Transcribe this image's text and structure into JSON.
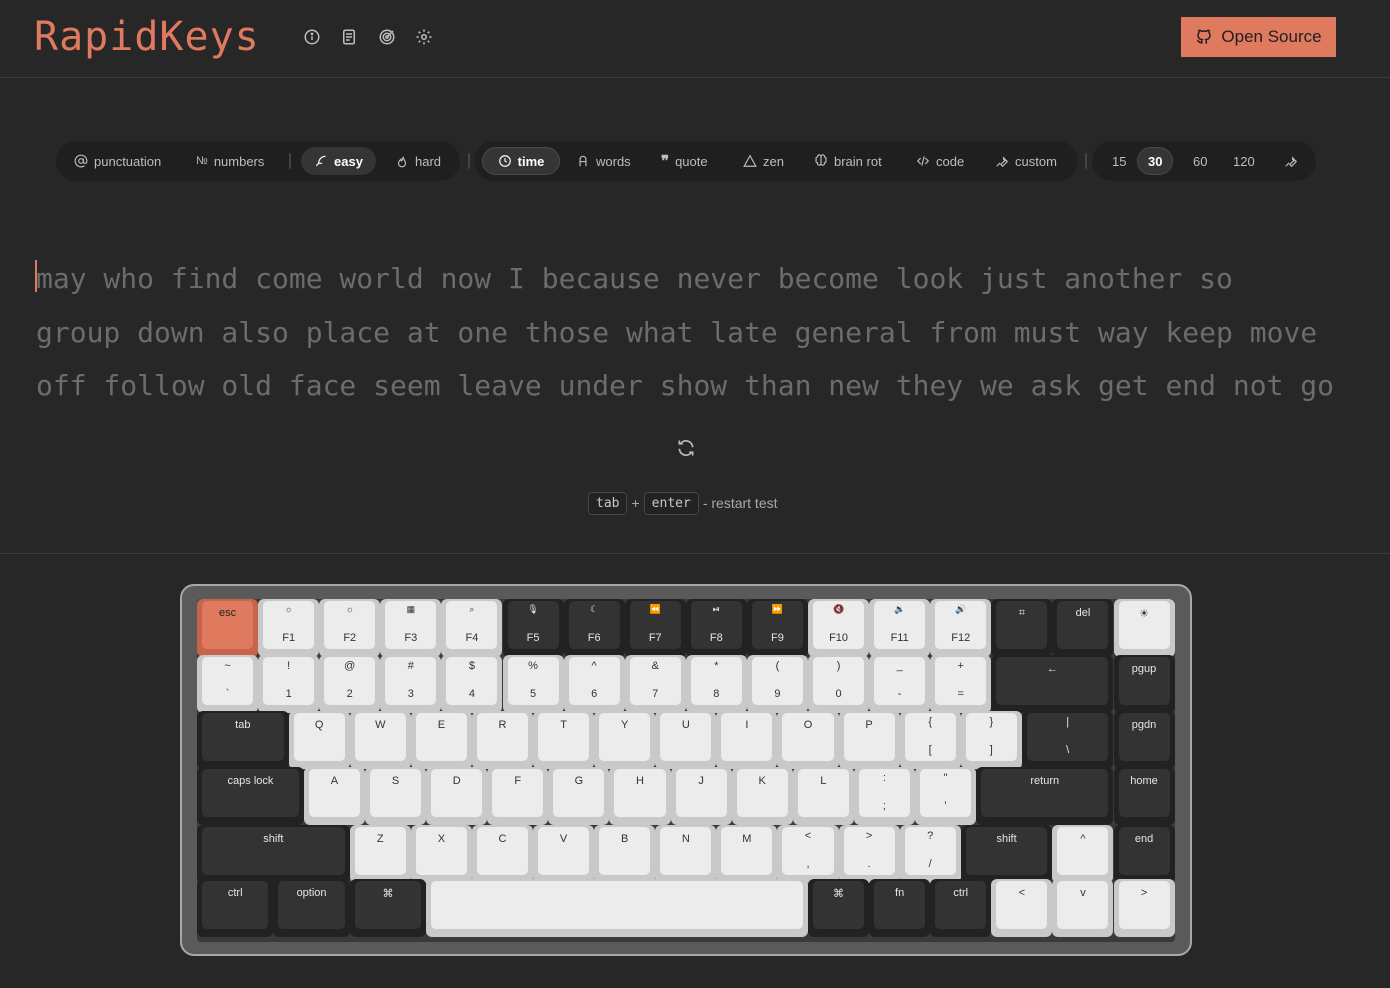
{
  "header": {
    "logo": "RapidKeys",
    "icons": [
      "info-icon",
      "document-icon",
      "target-icon",
      "settings-icon"
    ],
    "open_source_label": "Open Source"
  },
  "toolbar": {
    "punctuation": "punctuation",
    "numbers": "numbers",
    "easy": "easy",
    "hard": "hard",
    "time": "time",
    "words": "words",
    "quote": "quote",
    "zen": "zen",
    "brain_rot": "brain rot",
    "code": "code",
    "custom": "custom",
    "durations": [
      "15",
      "30",
      "60",
      "120"
    ],
    "selected_duration": "30"
  },
  "test": {
    "line1": "may who find come world now I because never become look just another so",
    "line2": "group down also place at one those what late general from must way keep move",
    "line3": "off follow old face seem leave under show than new they we ask get end not go"
  },
  "hint": {
    "key1": "tab",
    "plus": "+",
    "key2": "enter",
    "text": "- restart test"
  },
  "keyboard": {
    "row1": [
      {
        "top": "esc",
        "bottom": ""
      },
      {
        "icon": "☼",
        "bottom": "F1"
      },
      {
        "icon": "☼",
        "bottom": "F2"
      },
      {
        "icon": "▦",
        "bottom": "F3"
      },
      {
        "icon": "⌕",
        "bottom": "F4"
      },
      {
        "icon": "🎙",
        "bottom": "F5"
      },
      {
        "icon": "☾",
        "bottom": "F6"
      },
      {
        "icon": "⏪",
        "bottom": "F7"
      },
      {
        "icon": "⏯",
        "bottom": "F8"
      },
      {
        "icon": "⏩",
        "bottom": "F9"
      },
      {
        "icon": "🔇",
        "bottom": "F10"
      },
      {
        "icon": "🔉",
        "bottom": "F11"
      },
      {
        "icon": "🔊",
        "bottom": "F12"
      },
      {
        "top": "⌗",
        "bottom": ""
      },
      {
        "top": "del",
        "bottom": ""
      },
      {
        "top": "☀",
        "bottom": ""
      }
    ],
    "row2": [
      {
        "top": "~",
        "bottom": "`"
      },
      {
        "top": "!",
        "bottom": "1"
      },
      {
        "top": "@",
        "bottom": "2"
      },
      {
        "top": "#",
        "bottom": "3"
      },
      {
        "top": "$",
        "bottom": "4"
      },
      {
        "top": "%",
        "bottom": "5"
      },
      {
        "top": "^",
        "bottom": "6"
      },
      {
        "top": "&",
        "bottom": "7"
      },
      {
        "top": "*",
        "bottom": "8"
      },
      {
        "top": "(",
        "bottom": "9"
      },
      {
        "top": ")",
        "bottom": "0"
      },
      {
        "top": "_",
        "bottom": "-"
      },
      {
        "top": "+",
        "bottom": "="
      },
      {
        "top": "←",
        "bottom": ""
      },
      {
        "top": "pgup",
        "bottom": ""
      }
    ],
    "row3": [
      {
        "top": "tab",
        "bottom": ""
      },
      {
        "top": "Q",
        "bottom": ""
      },
      {
        "top": "W",
        "bottom": ""
      },
      {
        "top": "E",
        "bottom": ""
      },
      {
        "top": "R",
        "bottom": ""
      },
      {
        "top": "T",
        "bottom": ""
      },
      {
        "top": "Y",
        "bottom": ""
      },
      {
        "top": "U",
        "bottom": ""
      },
      {
        "top": "I",
        "bottom": ""
      },
      {
        "top": "O",
        "bottom": ""
      },
      {
        "top": "P",
        "bottom": ""
      },
      {
        "top": "{",
        "bottom": "["
      },
      {
        "top": "}",
        "bottom": "]"
      },
      {
        "top": "|",
        "bottom": "\\"
      },
      {
        "top": "pgdn",
        "bottom": ""
      }
    ],
    "row4": [
      {
        "top": "caps lock",
        "bottom": ""
      },
      {
        "top": "A",
        "bottom": ""
      },
      {
        "top": "S",
        "bottom": ""
      },
      {
        "top": "D",
        "bottom": ""
      },
      {
        "top": "F",
        "bottom": ""
      },
      {
        "top": "G",
        "bottom": ""
      },
      {
        "top": "H",
        "bottom": ""
      },
      {
        "top": "J",
        "bottom": ""
      },
      {
        "top": "K",
        "bottom": ""
      },
      {
        "top": "L",
        "bottom": ""
      },
      {
        "top": ":",
        "bottom": ";"
      },
      {
        "top": "\"",
        "bottom": "'"
      },
      {
        "top": "return",
        "bottom": ""
      },
      {
        "top": "home",
        "bottom": ""
      }
    ],
    "row5": [
      {
        "top": "shift",
        "bottom": ""
      },
      {
        "top": "Z",
        "bottom": ""
      },
      {
        "top": "X",
        "bottom": ""
      },
      {
        "top": "C",
        "bottom": ""
      },
      {
        "top": "V",
        "bottom": ""
      },
      {
        "top": "B",
        "bottom": ""
      },
      {
        "top": "N",
        "bottom": ""
      },
      {
        "top": "M",
        "bottom": ""
      },
      {
        "top": "<",
        "bottom": ","
      },
      {
        "top": ">",
        "bottom": "."
      },
      {
        "top": "?",
        "bottom": "/"
      },
      {
        "top": "shift",
        "bottom": ""
      },
      {
        "top": "^",
        "bottom": ""
      },
      {
        "top": "end",
        "bottom": ""
      }
    ],
    "row6": [
      {
        "top": "ctrl",
        "bottom": ""
      },
      {
        "top": "option",
        "bottom": ""
      },
      {
        "top": "⌘",
        "bottom": ""
      },
      {
        "top": "",
        "bottom": ""
      },
      {
        "top": "⌘",
        "bottom": ""
      },
      {
        "top": "fn",
        "bottom": ""
      },
      {
        "top": "ctrl",
        "bottom": ""
      },
      {
        "top": "<",
        "bottom": ""
      },
      {
        "top": "v",
        "bottom": ""
      },
      {
        "top": ">",
        "bottom": ""
      }
    ]
  },
  "colors": {
    "accent": "#e07a5f",
    "background": "#272727",
    "toolbar_bg": "#1f1f1f",
    "text_untyped": "#6c6c6c"
  }
}
